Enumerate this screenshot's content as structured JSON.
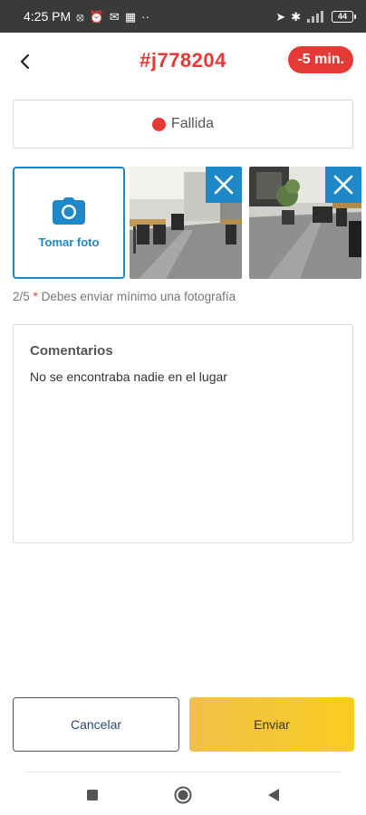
{
  "status_bar": {
    "time": "4:25 PM",
    "left_icons": [
      "data-saver-icon",
      "alarm-icon",
      "message-icon",
      "apps-icon",
      "more-dots-icon"
    ],
    "right_icons": [
      "location-icon",
      "bluetooth-icon",
      "signal-icon"
    ],
    "battery": "44"
  },
  "header": {
    "order_id": "#j778204",
    "time_badge": "-5 min."
  },
  "status_field": {
    "value": "Fallida",
    "color": "#e53935"
  },
  "photos": {
    "take_photo_label": "Tomar foto",
    "count": "2/5",
    "hint_star": "*",
    "hint": "Debes enviar mínimo una fotografía",
    "items": [
      {
        "alt": "office-photo-1"
      },
      {
        "alt": "office-photo-2"
      }
    ]
  },
  "comments": {
    "label": "Comentarios",
    "value": "No se encontraba nadie en el lugar"
  },
  "actions": {
    "cancel_label": "Cancelar",
    "send_label": "Enviar"
  },
  "colors": {
    "accent_red": "#e53935",
    "accent_blue": "#1e88c8",
    "send_yellow": "#f9cd1f"
  }
}
